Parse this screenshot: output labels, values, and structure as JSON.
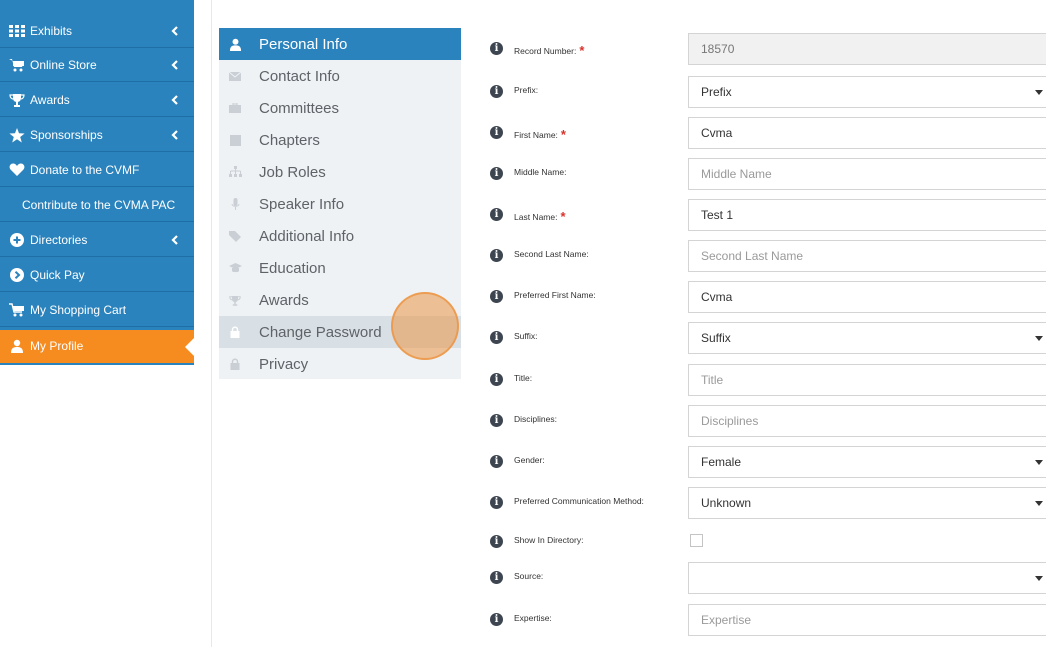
{
  "nav": {
    "items": [
      {
        "label": "Exhibits",
        "icon": "grid-icon",
        "chevron": true
      },
      {
        "label": "Online Store",
        "icon": "cart-icon",
        "chevron": true
      },
      {
        "label": "Awards",
        "icon": "trophy-icon",
        "chevron": true
      },
      {
        "label": "Sponsorships",
        "icon": "star-icon",
        "chevron": true
      },
      {
        "label": "Donate to the CVMF",
        "icon": "heart-icon",
        "chevron": false
      },
      {
        "label": "Contribute to the CVMA PAC",
        "icon": "",
        "chevron": false
      },
      {
        "label": "Directories",
        "icon": "plus-circle-icon",
        "chevron": true
      },
      {
        "label": "Quick Pay",
        "icon": "arrow-circle-icon",
        "chevron": false
      },
      {
        "label": "My Shopping Cart",
        "icon": "cart-icon",
        "chevron": false
      },
      {
        "label": "My Profile",
        "icon": "user-icon",
        "chevron": false,
        "active": true
      }
    ]
  },
  "profile_menu": {
    "items": [
      {
        "label": "Personal Info",
        "icon": "user-icon",
        "active": true
      },
      {
        "label": "Contact Info",
        "icon": "envelope-icon"
      },
      {
        "label": "Committees",
        "icon": "briefcase-icon"
      },
      {
        "label": "Chapters",
        "icon": "book-icon"
      },
      {
        "label": "Job Roles",
        "icon": "sitemap-icon"
      },
      {
        "label": "Speaker Info",
        "icon": "microphone-icon"
      },
      {
        "label": "Additional Info",
        "icon": "tags-icon"
      },
      {
        "label": "Education",
        "icon": "graduation-cap-icon"
      },
      {
        "label": "Awards",
        "icon": "trophy-icon"
      },
      {
        "label": "Change Password",
        "icon": "lock-icon",
        "hover": true
      },
      {
        "label": "Privacy",
        "icon": "lock-icon"
      }
    ]
  },
  "form": {
    "fields": [
      {
        "label": "Record Number:",
        "required": true,
        "type": "readonly",
        "value": "18570"
      },
      {
        "label": "Prefix:",
        "type": "select",
        "value": "Prefix"
      },
      {
        "label": "First Name:",
        "required": true,
        "type": "text",
        "value": "Cvma"
      },
      {
        "label": "Middle Name:",
        "type": "text",
        "placeholder": "Middle Name"
      },
      {
        "label": "Last Name:",
        "required": true,
        "type": "text",
        "value": "Test 1"
      },
      {
        "label": "Second Last Name:",
        "type": "text",
        "placeholder": "Second Last Name"
      },
      {
        "label": "Preferred First Name:",
        "type": "text",
        "value": "Cvma"
      },
      {
        "label": "Suffix:",
        "type": "select",
        "value": "Suffix"
      },
      {
        "label": "Title:",
        "type": "text",
        "placeholder": "Title"
      },
      {
        "label": "Disciplines:",
        "type": "text",
        "placeholder": "Disciplines"
      },
      {
        "label": "Gender:",
        "type": "select",
        "value": "Female"
      },
      {
        "label": "Preferred Communication Method:",
        "type": "select",
        "value": "Unknown"
      },
      {
        "label": "Show In Directory:",
        "type": "checkbox",
        "checked": false
      },
      {
        "label": "Source:",
        "type": "select",
        "value": ""
      },
      {
        "label": "Expertise:",
        "type": "text",
        "placeholder": "Expertise"
      }
    ]
  },
  "colors": {
    "nav_bg": "#2b83bd",
    "nav_active": "#f68b1f",
    "menu_active": "#2b83bd",
    "menu_bg": "#eef2f5",
    "required": "#d9322b"
  }
}
